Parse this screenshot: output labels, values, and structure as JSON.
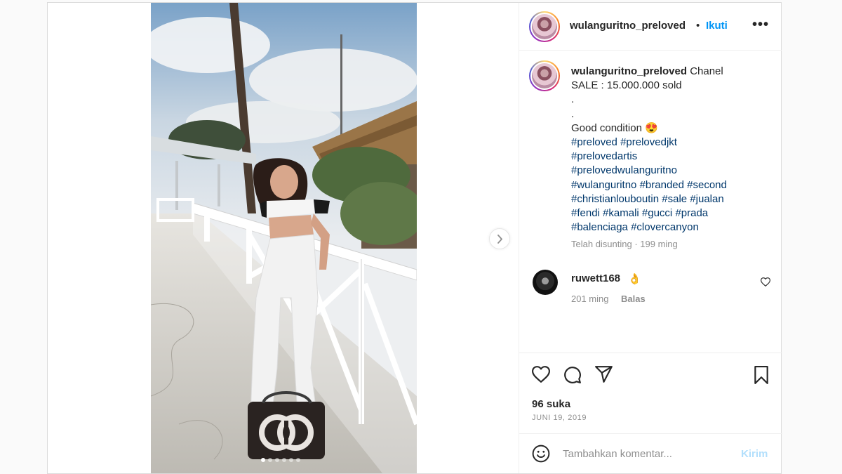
{
  "post": {
    "username": "wulanguritno_preloved",
    "separator": "•",
    "follow_label": "Ikuti",
    "more_label": "•••"
  },
  "caption": {
    "username": "wulanguritno_preloved",
    "lines": [
      "Chanel",
      "SALE : 15.000.000 sold",
      ".",
      ".",
      "Good condition 😍"
    ],
    "hashtag_lines": [
      [
        "#preloved",
        "#prelovedjkt"
      ],
      [
        "#prelovedartis"
      ],
      [
        "#prelovedwulanguritno"
      ],
      [
        "#wulanguritno",
        "#branded",
        "#second"
      ],
      [
        "#christianlouboutin",
        "#sale",
        "#jualan"
      ],
      [
        "#fendi",
        "#kamali",
        "#gucci",
        "#prada"
      ],
      [
        "#balenciaga",
        "#clovercanyon"
      ]
    ],
    "meta": "Telah disunting · 199 ming"
  },
  "comment": {
    "username": "ruwett168",
    "emoji": "👌",
    "time": "201 ming",
    "reply_label": "Balas"
  },
  "actions": {
    "likes": "96 suka",
    "date": "JUNI 19, 2019"
  },
  "add_comment": {
    "placeholder": "Tambahkan komentar...",
    "post_label": "Kirim"
  },
  "carousel": {
    "slide_count": 6,
    "current_slide": 1
  },
  "colors": {
    "link": "#00376b",
    "follow": "#0095f6",
    "post_disabled": "#b2dffc",
    "muted": "#8e8e8e"
  },
  "icons": [
    "next-icon",
    "more-icon",
    "heart-icon",
    "comment-icon",
    "share-icon",
    "bookmark-icon",
    "emoji-icon"
  ]
}
